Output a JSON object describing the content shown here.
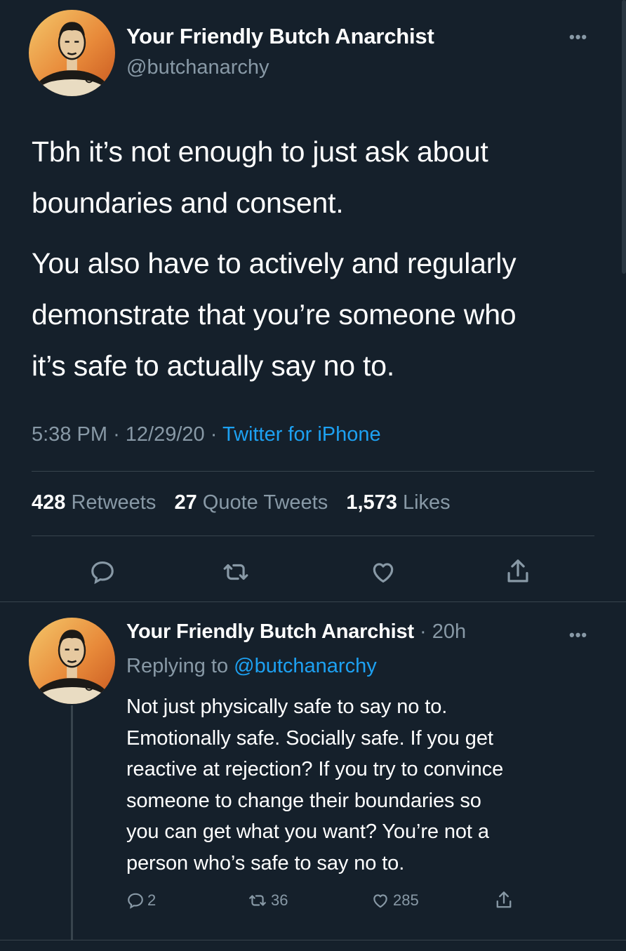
{
  "main_tweet": {
    "display_name": "Your Friendly Butch Anarchist",
    "handle": "@butchanarchy",
    "more": "•••",
    "paragraph1_lines": [
      "Tbh it’s not enough to just ask about",
      "boundaries and consent."
    ],
    "paragraph2_lines": [
      "You also have to actively and regularly",
      "demonstrate that you’re someone who",
      "it’s safe to actually say no to."
    ],
    "time": "5:38 PM",
    "date": "12/29/20",
    "source": "Twitter for iPhone",
    "sep": "·",
    "retweets_count": "428",
    "retweets_label": "Retweets",
    "quotes_count": "27",
    "quotes_label": "Quote Tweets",
    "likes_count": "1,573",
    "likes_label": "Likes"
  },
  "reply": {
    "display_name": "Your Friendly Butch Anarchist",
    "age": "· 20h",
    "more": "•••",
    "replying_prefix": "Replying to",
    "replying_handle": "@butchanarchy",
    "lines": [
      "Not just physically safe to say no to.",
      "Emotionally safe. Socially safe. If you get",
      "reactive at rejection? If you try to convince",
      "someone to change their boundaries so",
      "you can get what you want? You’re not a",
      "person who’s safe to say no to."
    ],
    "reply_count": "2",
    "retweet_count": "36",
    "like_count": "285"
  },
  "icons": {
    "reply": "reply-icon",
    "retweet": "retweet-icon",
    "like": "heart-icon",
    "share": "share-icon"
  },
  "colors": {
    "background": "#15202b",
    "secondary_text": "#8899a6",
    "accent": "#1da1f2",
    "divider": "#38444d"
  }
}
